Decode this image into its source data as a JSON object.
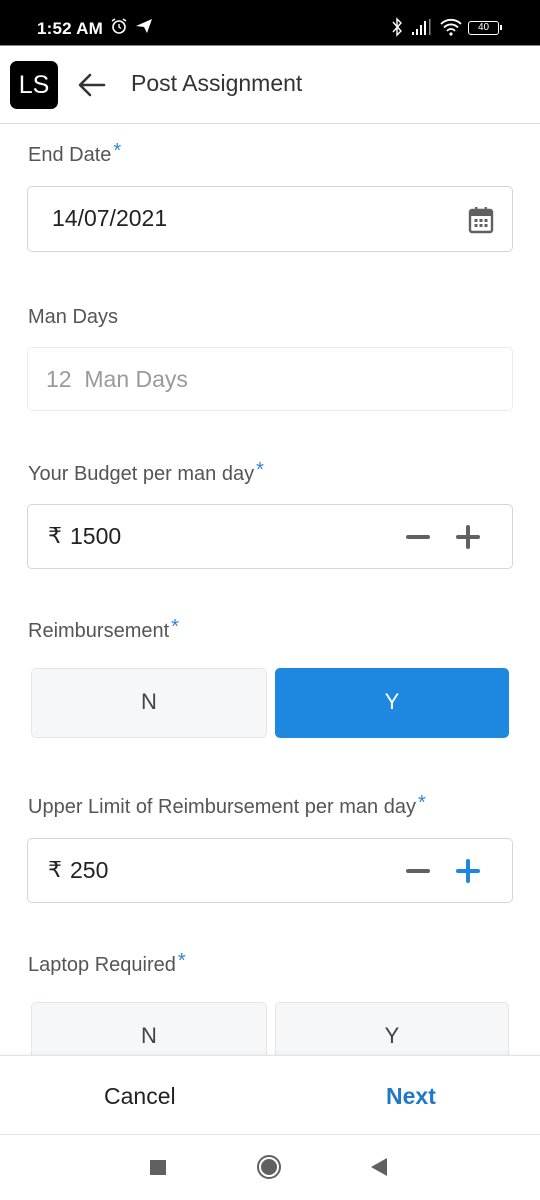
{
  "status_bar": {
    "time": "1:52 AM",
    "battery": "40",
    "icons": [
      "alarm-icon",
      "telegram-icon",
      "bluetooth-icon",
      "signal-icon",
      "wifi-icon",
      "battery-icon"
    ]
  },
  "app_bar": {
    "logo": "LS",
    "title": "Post Assignment",
    "back_icon": "arrow-left-icon"
  },
  "form": {
    "required_marker": "*",
    "end_date": {
      "label": "End Date",
      "value": "14/07/2021",
      "icon": "calendar-icon"
    },
    "man_days": {
      "label": "Man Days",
      "value": "12  Man Days"
    },
    "budget": {
      "label": "Your Budget per man day",
      "currency": "₹",
      "value": "1500"
    },
    "reimbursement": {
      "label": "Reimbursement",
      "options": [
        "N",
        "Y"
      ],
      "selected": "Y"
    },
    "reimbursement_limit": {
      "label": "Upper Limit of Reimbursement per man day",
      "currency": "₹",
      "value": "250"
    },
    "laptop_required": {
      "label": "Laptop Required",
      "options": [
        "N",
        "Y"
      ],
      "selected": null
    }
  },
  "actions": {
    "cancel": "Cancel",
    "next": "Next"
  },
  "colors": {
    "accent": "#1e88e0",
    "link": "#1f78c8",
    "required": "#2e86d6"
  }
}
